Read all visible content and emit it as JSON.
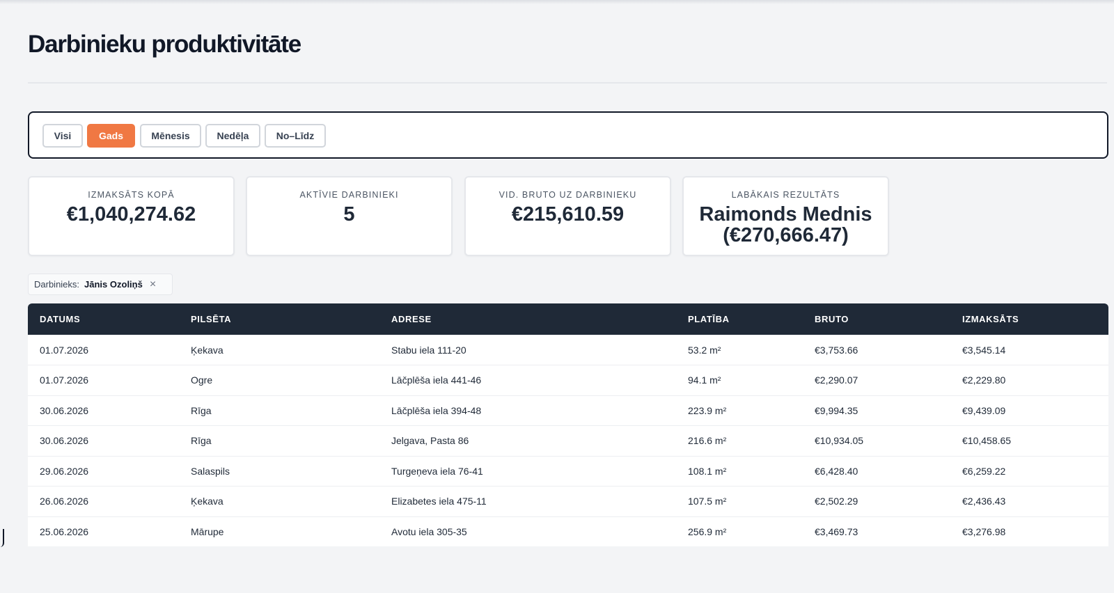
{
  "page": {
    "title": "Darbinieku produktivitāte"
  },
  "filters": [
    {
      "label": "Visi",
      "active": false
    },
    {
      "label": "Gads",
      "active": true
    },
    {
      "label": "Mēnesis",
      "active": false
    },
    {
      "label": "Nedēļa",
      "active": false
    },
    {
      "label": "No–Līdz",
      "active": false
    }
  ],
  "stats": [
    {
      "label": "IZMAKSĀTS KOPĀ",
      "value": "€1,040,274.62"
    },
    {
      "label": "AKTĪVIE DARBINIEKI",
      "value": "5"
    },
    {
      "label": "VID. BRUTO UZ DARBINIEKU",
      "value": "€215,610.59"
    },
    {
      "label": "LABĀKAIS REZULTĀTS",
      "value": "Raimonds Mednis (€270,666.47)"
    }
  ],
  "employee_filter": {
    "label": "Darbinieks:",
    "value": "Jānis Ozoliņš",
    "close_icon": "close-icon"
  },
  "table": {
    "columns": [
      "DATUMS",
      "PILSĒTA",
      "ADRESE",
      "PLATĪBA",
      "BRUTO",
      "IZMAKSĀTS"
    ],
    "rows": [
      [
        "01.07.2026",
        "Ķekava",
        "Stabu iela 111-20",
        "53.2 m²",
        "€3,753.66",
        "€3,545.14"
      ],
      [
        "01.07.2026",
        "Ogre",
        "Lāčplēša iela 441-46",
        "94.1 m²",
        "€2,290.07",
        "€2,229.80"
      ],
      [
        "30.06.2026",
        "Rīga",
        "Lāčplēša iela 394-48",
        "223.9 m²",
        "€9,994.35",
        "€9,439.09"
      ],
      [
        "30.06.2026",
        "Rīga",
        "Jelgava, Pasta 86",
        "216.6 m²",
        "€10,934.05",
        "€10,458.65"
      ],
      [
        "29.06.2026",
        "Salaspils",
        "Turgeņeva iela 76-41",
        "108.1 m²",
        "€6,428.40",
        "€6,259.22"
      ],
      [
        "26.06.2026",
        "Ķekava",
        "Elizabetes iela 475-11",
        "107.5 m²",
        "€2,502.29",
        "€2,436.43"
      ],
      [
        "25.06.2026",
        "Mārupe",
        "Avotu iela 305-35",
        "256.9 m²",
        "€3,469.73",
        "€3,276.98"
      ]
    ]
  },
  "colors": {
    "accent": "#f07843",
    "header_bg": "#1f2937",
    "page_bg": "#f3f4f6"
  }
}
